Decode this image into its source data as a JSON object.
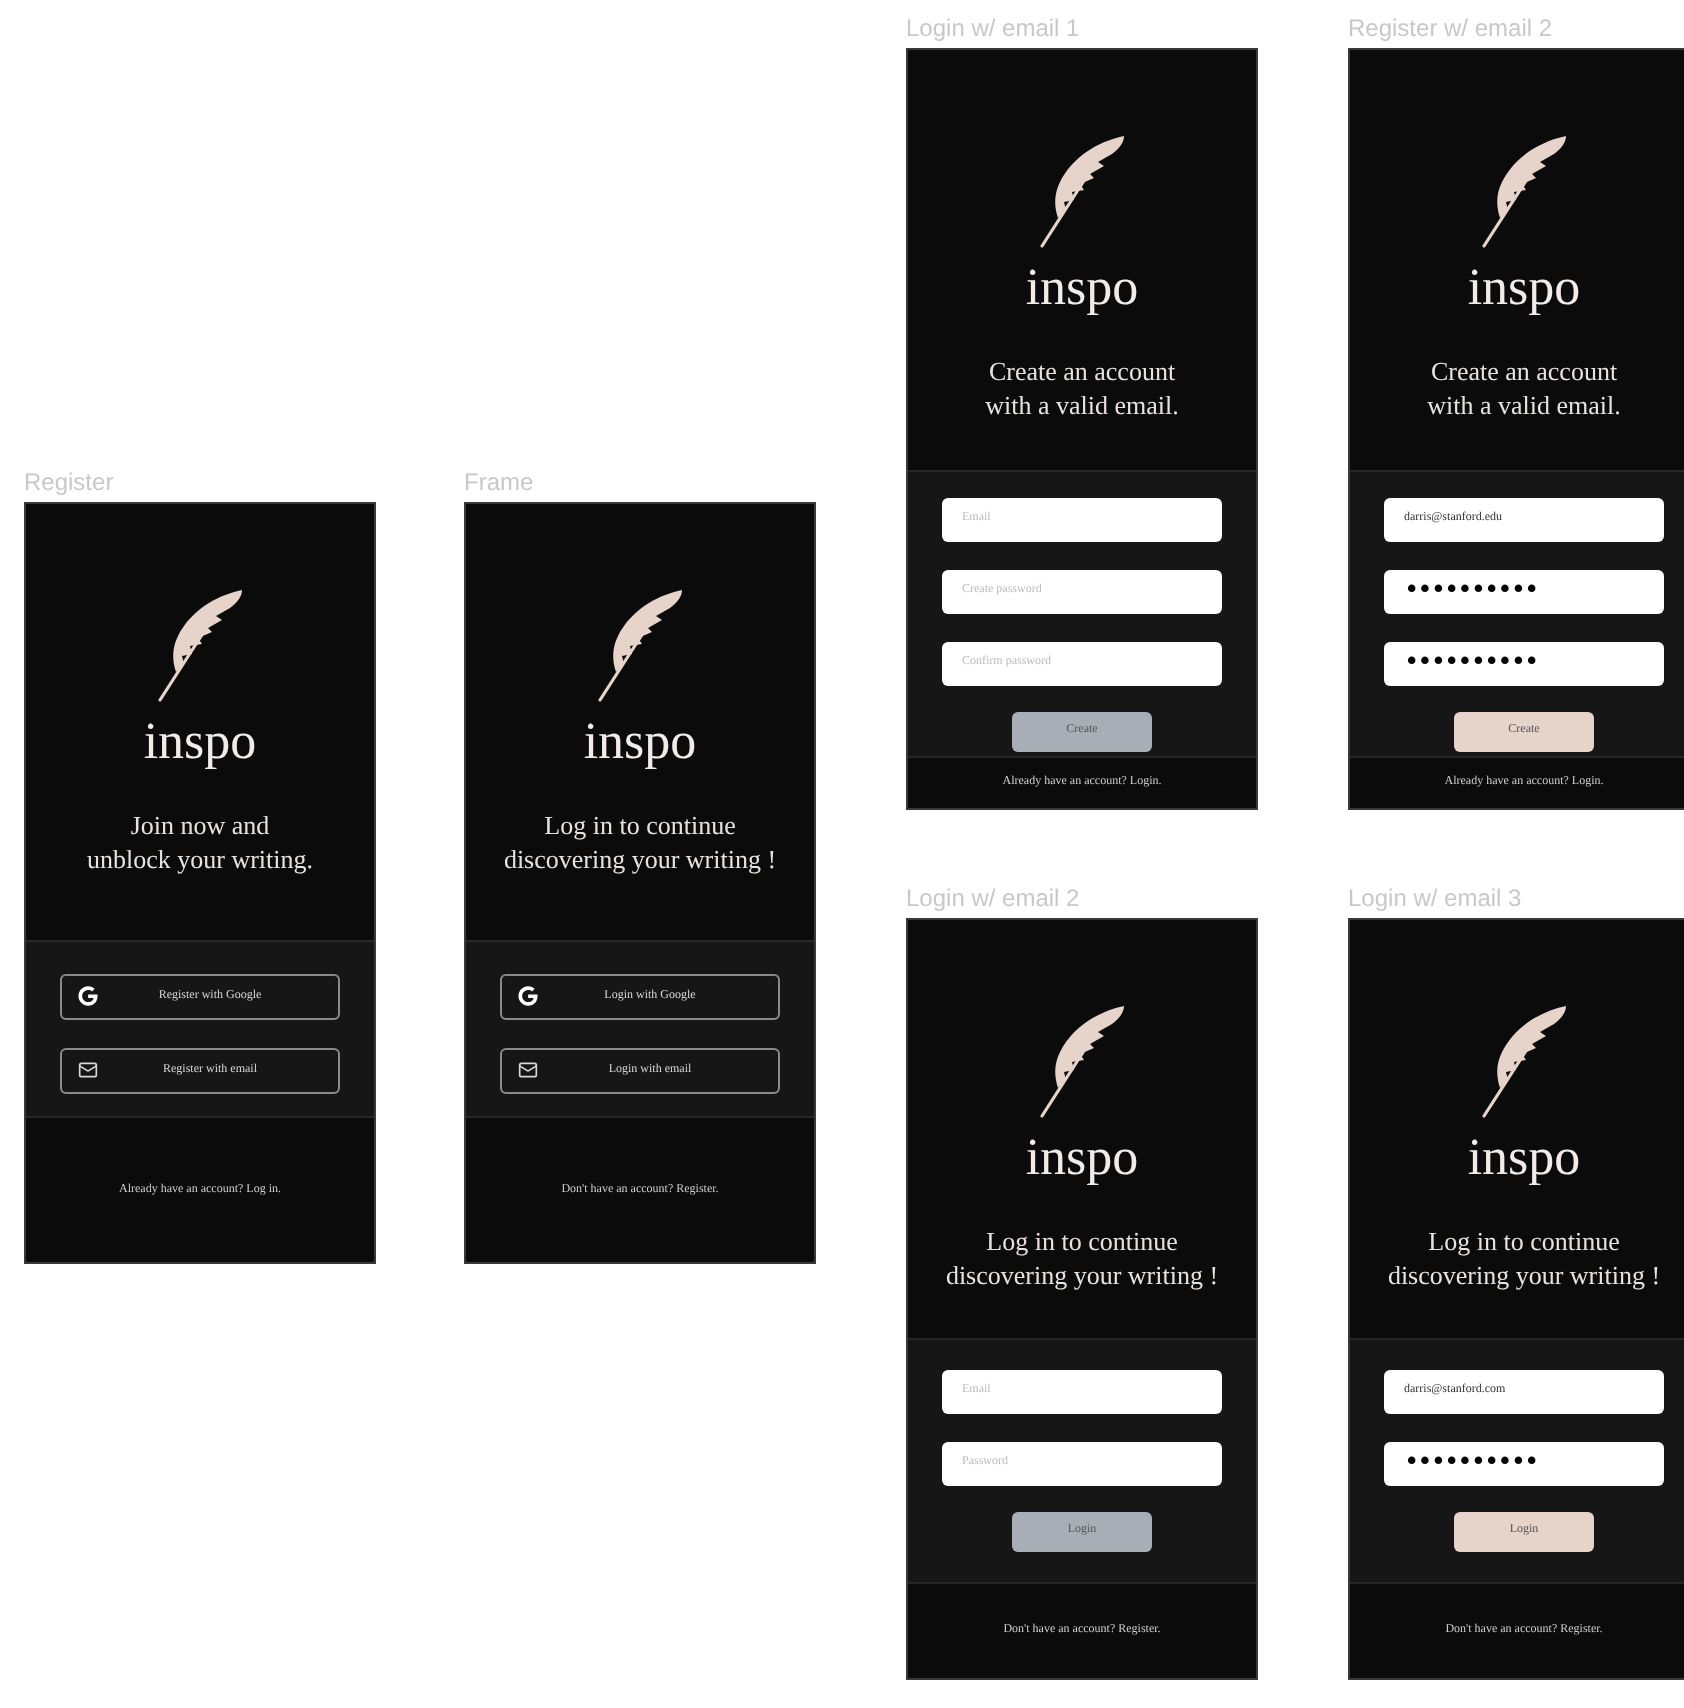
{
  "frames": [
    {
      "label": "Register",
      "kind": "social",
      "brand": "inspo",
      "heading": "Join now and unblock your writing.",
      "buttons": [
        {
          "label": "Register with Google"
        },
        {
          "label": "Register with email"
        }
      ],
      "footer": "Already have an account? Log in."
    },
    {
      "label": "Frame",
      "kind": "social",
      "brand": "inspo",
      "heading": "Log in to continue discovering your writing !",
      "buttons": [
        {
          "label": "Login with Google"
        },
        {
          "label": "Login with email"
        }
      ],
      "footer": "Don't have an account? Register."
    },
    {
      "label": "Login w/ email 1",
      "kind": "create",
      "brand": "inspo",
      "heading": "Create an account with a valid email.",
      "fields": [
        {
          "placeholder": "Email"
        },
        {
          "placeholder": "Create password"
        },
        {
          "placeholder": "Confirm password"
        }
      ],
      "submit": {
        "label": "Create",
        "disabled": true
      },
      "footer": "Already have an account? Login."
    },
    {
      "label": "Register w/ email 2",
      "kind": "create",
      "brand": "inspo",
      "heading": "Create an account with a valid email.",
      "fields": [
        {
          "kind": "text",
          "value": "darris@stanford.edu"
        },
        {
          "kind": "password",
          "value": "••••••••••"
        },
        {
          "kind": "password",
          "value": "••••••••••"
        }
      ],
      "submit": {
        "label": "Create",
        "disabled": false
      },
      "footer": "Already have an account? Login."
    },
    {
      "label": "Login w/ email 2",
      "kind": "login",
      "brand": "inspo",
      "heading": "Log in to continue discovering your writing !",
      "fields": [
        {
          "placeholder": "Email"
        },
        {
          "placeholder": "Password"
        }
      ],
      "submit": {
        "label": "Login",
        "disabled": true
      },
      "footer": "Don't have an account? Register."
    },
    {
      "label": "Login w/ email 3",
      "kind": "login",
      "brand": "inspo",
      "heading": "Log in to continue discovering your writing !",
      "fields": [
        {
          "kind": "text",
          "value": "darris@stanford.com"
        },
        {
          "kind": "password",
          "value": "••••••••••"
        }
      ],
      "submit": {
        "label": "Login",
        "disabled": false
      },
      "footer": "Don't have an account? Register."
    }
  ]
}
